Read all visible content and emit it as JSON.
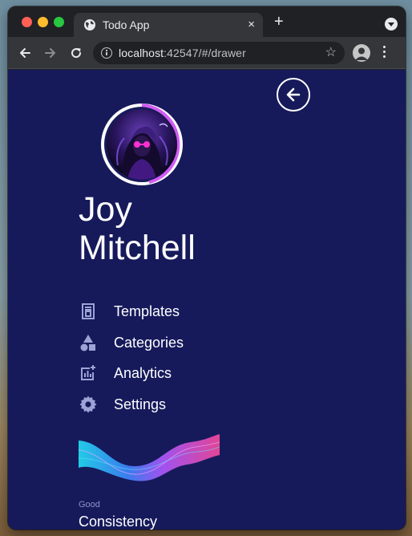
{
  "browser": {
    "tab_title": "Todo App",
    "tab_close": "×",
    "new_tab": "+",
    "url_host": "localhost",
    "url_rest": ":42547/#/drawer",
    "star": "☆"
  },
  "drawer": {
    "user_first_name": "Joy",
    "user_last_name": "Mitchell",
    "menu": [
      {
        "label": "Templates",
        "icon": "templates-icon"
      },
      {
        "label": "Categories",
        "icon": "categories-icon"
      },
      {
        "label": "Analytics",
        "icon": "analytics-icon"
      },
      {
        "label": "Settings",
        "icon": "gear-icon"
      }
    ],
    "stat": {
      "caption": "Good",
      "value": "Consistency"
    }
  },
  "colors": {
    "drawer_background": "#161a5b",
    "icon_color": "#9ea3d6",
    "avatar_ring_accent": "#d15cf5"
  }
}
